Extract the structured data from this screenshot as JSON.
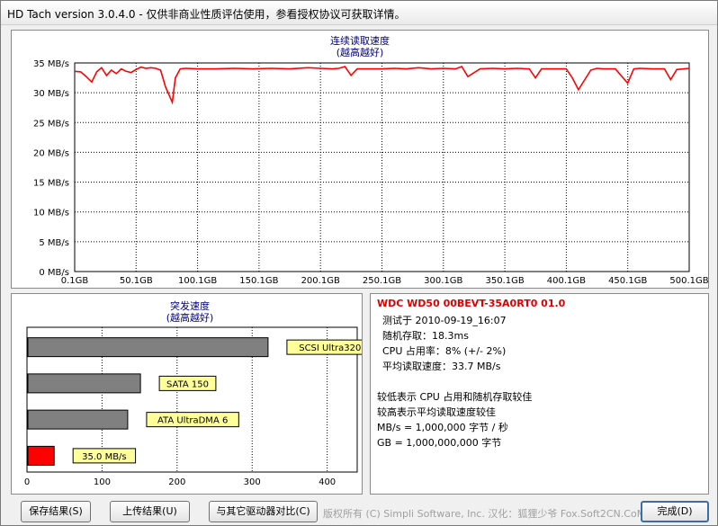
{
  "window": {
    "title": "HD Tach version 3.0.4.0 - 仅供非商业性质评估使用，参看授权协议可获取详情。"
  },
  "read_chart": {
    "title_line1": "连续读取速度",
    "title_line2": "(越高越好)",
    "chart_data": {
      "type": "line",
      "title": "连续读取速度 (越高越好)",
      "y_ticks": [
        "35 MB/s",
        "30 MB/s",
        "25 MB/s",
        "20 MB/s",
        "15 MB/s",
        "10 MB/s",
        "5 MB/s",
        "0 MB/s"
      ],
      "x_ticks": [
        "0.1GB",
        "50.1GB",
        "100.1GB",
        "150.1GB",
        "200.1GB",
        "250.1GB",
        "300.1GB",
        "350.1GB",
        "400.1GB",
        "450.1GB",
        "500.1GB"
      ],
      "ylim": [
        0,
        35
      ],
      "xlim": [
        0.1,
        500.1
      ],
      "grid": true,
      "series": [
        {
          "color": "#ff0000",
          "x": [
            0.1,
            5,
            9,
            14,
            18,
            22,
            26,
            30,
            34,
            38,
            42,
            46,
            50,
            54,
            58,
            62,
            66,
            70,
            74,
            78,
            79.5,
            82,
            86,
            90,
            100,
            115,
            130,
            145,
            160,
            175,
            190,
            200,
            210,
            215,
            220,
            225,
            230,
            240,
            250,
            260,
            270,
            280,
            290,
            300,
            310,
            315,
            320,
            330,
            340,
            350,
            360,
            370,
            375,
            380,
            390,
            400,
            405,
            410,
            420,
            425,
            430,
            440,
            450,
            455,
            460,
            470,
            480,
            485,
            490,
            500.1
          ],
          "y": [
            33.6,
            33.5,
            32.8,
            31.8,
            33.5,
            34.2,
            32.9,
            33.8,
            33.2,
            34.0,
            33.6,
            33.4,
            33.9,
            34.3,
            34.1,
            34.2,
            34.1,
            33.8,
            31.0,
            29.1,
            28.4,
            32.5,
            34.0,
            34.1,
            34.0,
            34.0,
            34.1,
            34.0,
            34.1,
            34.0,
            34.2,
            34.1,
            34.0,
            34.1,
            34.4,
            32.9,
            34.0,
            34.0,
            34.0,
            34.1,
            34.0,
            34.2,
            34.0,
            34.1,
            34.0,
            34.4,
            32.7,
            34.0,
            34.1,
            34.0,
            34.1,
            34.0,
            32.5,
            34.0,
            34.0,
            34.0,
            32.5,
            30.5,
            33.8,
            34.1,
            34.0,
            34.0,
            31.6,
            34.0,
            34.1,
            34.0,
            34.0,
            32.2,
            33.9,
            34.1
          ]
        }
      ]
    }
  },
  "burst_chart": {
    "title_line1": "突发速度",
    "title_line2": "(越高越好)",
    "chart_data": {
      "type": "bar",
      "title": "突发速度 (越高越好)",
      "orientation": "horizontal",
      "xlim": [
        0,
        440
      ],
      "x_ticks": [
        0,
        100,
        200,
        300,
        400
      ],
      "grid": true,
      "bars": [
        {
          "label": "SCSI Ultra320",
          "value": 320,
          "color": "#808080"
        },
        {
          "label": "SATA 150",
          "value": 150,
          "color": "#808080"
        },
        {
          "label": "ATA UltraDMA 6",
          "value": 133,
          "color": "#808080"
        },
        {
          "label": "35.0 MB/s",
          "value": 35,
          "color": "#ff0000"
        }
      ]
    }
  },
  "info": {
    "drive": "WDC WD50 00BEVT-35A0RT0 01.0",
    "test_date": "测试于 2010-09-19_16:07",
    "random_access": "随机存取：18.3ms",
    "cpu_usage": "CPU 占用率：8% (+/- 2%)",
    "avg_speed": "平均读取速度：33.7 MB/s",
    "note1": "较低表示 CPU 占用和随机存取较佳",
    "note2": "较高表示平均读取速度较佳",
    "unit_mb": "MB/s = 1,000,000 字节 / 秒",
    "unit_gb": "GB = 1,000,000,000 字节"
  },
  "buttons": {
    "save": "保存结果(S)",
    "upload": "上传结果(U)",
    "compare": "与其它驱动器对比(C)",
    "done": "完成(D)"
  },
  "copyright": "版权所有 (C) Simpli Software, Inc. 汉化：狐狸少爷 Fox.Soft2CN.CoM"
}
